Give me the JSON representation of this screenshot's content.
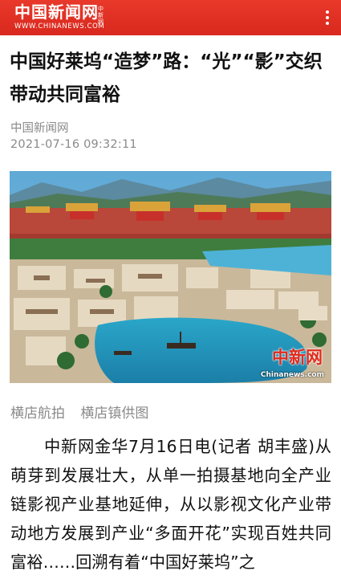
{
  "header": {
    "logo_cn": "中国新闻网",
    "logo_badge": "中新网",
    "logo_url": "WWW.CHINANEWS.COM",
    "bg_color": "#e0301f",
    "menu_icon": "more-vertical-icon"
  },
  "article": {
    "title": "中国好莱坞“造梦”路：“光”“影”交织带动共同富裕",
    "source": "中国新闻网",
    "date": "2021-07-16 09:32:11",
    "photo": {
      "watermark_cn": "中新网",
      "watermark_url": "Chinanews.com"
    },
    "caption": "横店航拍 横店镇供图",
    "body": "中新网金华7月16日电(记者 胡丰盛)从萌芽到发展壮大，从单一拍摄基地向全产业链影视产业基地延伸，从以影视文化产业带动地方发展到产业“多面开花”实现百姓共同富裕……回溯有着“中国好莱坞”之"
  }
}
